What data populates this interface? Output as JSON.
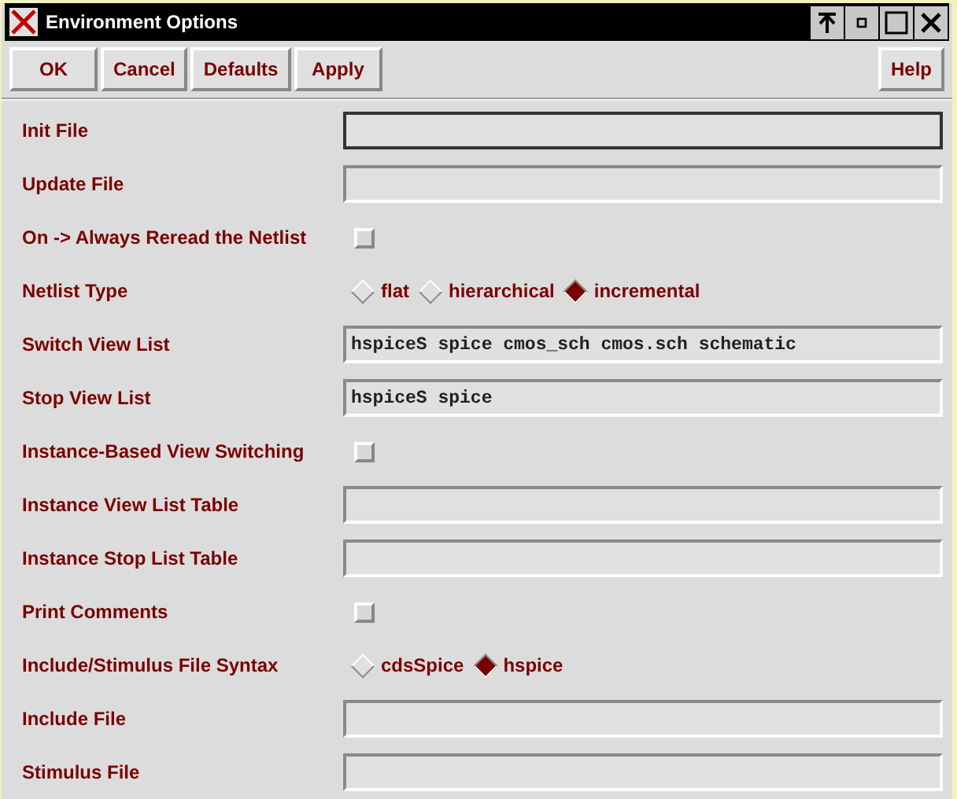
{
  "window": {
    "title": "Environment Options"
  },
  "buttons": [
    "OK",
    "Cancel",
    "Defaults",
    "Apply"
  ],
  "help_button": "Help",
  "rows": [
    {
      "kind": "field",
      "label": "Init File",
      "value": "",
      "focused": true
    },
    {
      "kind": "field",
      "label": "Update File",
      "value": "",
      "focused": false
    },
    {
      "kind": "checkbox",
      "label": "On -> Always Reread the Netlist",
      "checked": false
    },
    {
      "kind": "radio",
      "label": "Netlist Type",
      "options": [
        {
          "label": "flat",
          "selected": false
        },
        {
          "label": "hierarchical",
          "selected": false
        },
        {
          "label": "incremental",
          "selected": true
        }
      ]
    },
    {
      "kind": "field",
      "label": "Switch View List",
      "value": "hspiceS spice cmos_sch cmos.sch schematic",
      "focused": false
    },
    {
      "kind": "field",
      "label": "Stop View List",
      "value": "hspiceS spice",
      "focused": false
    },
    {
      "kind": "checkbox",
      "label": "Instance-Based View Switching",
      "checked": false
    },
    {
      "kind": "field",
      "label": "Instance View List Table",
      "value": "",
      "focused": false
    },
    {
      "kind": "field",
      "label": "Instance Stop List Table",
      "value": "",
      "focused": false
    },
    {
      "kind": "checkbox",
      "label": "Print Comments",
      "checked": false
    },
    {
      "kind": "radio",
      "label": "Include/Stimulus File Syntax",
      "options": [
        {
          "label": "cdsSpice",
          "selected": false
        },
        {
          "label": "hspice",
          "selected": true
        }
      ]
    },
    {
      "kind": "field",
      "label": "Include File",
      "value": "",
      "focused": false
    },
    {
      "kind": "field",
      "label": "Stimulus File",
      "value": "",
      "focused": false
    }
  ]
}
